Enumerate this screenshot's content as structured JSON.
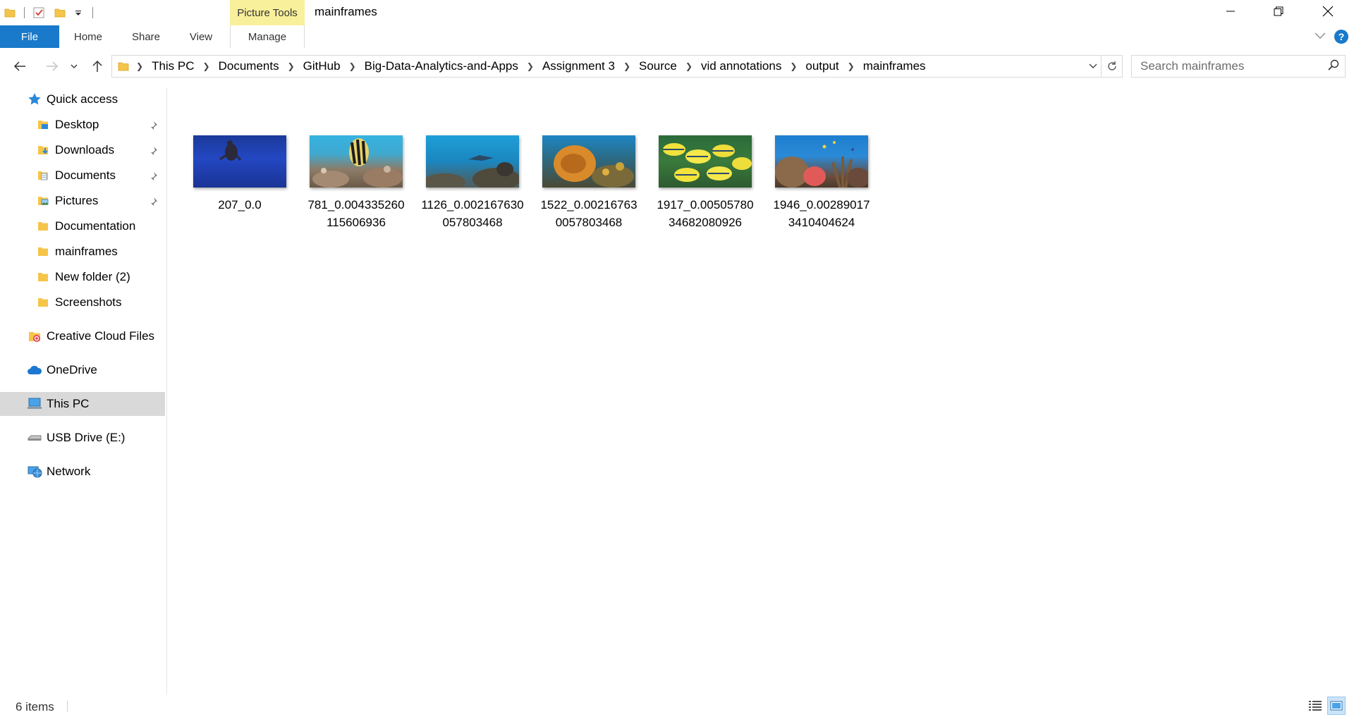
{
  "window": {
    "title": "mainframes",
    "context_tab_group": "Picture Tools"
  },
  "ribbon": {
    "tabs": [
      {
        "label": "File"
      },
      {
        "label": "Home"
      },
      {
        "label": "Share"
      },
      {
        "label": "View"
      },
      {
        "label": "Manage"
      }
    ]
  },
  "address_bar": {
    "breadcrumbs": [
      "This PC",
      "Documents",
      "GitHub",
      "Big-Data-Analytics-and-Apps",
      "Assignment 3",
      "Source",
      "vid annotations",
      "output",
      "mainframes"
    ]
  },
  "search": {
    "placeholder": "Search mainframes"
  },
  "nav_pane": {
    "quick_access": "Quick access",
    "pinned": [
      {
        "label": "Desktop",
        "icon": "desktop-folder-icon"
      },
      {
        "label": "Downloads",
        "icon": "downloads-folder-icon"
      },
      {
        "label": "Documents",
        "icon": "documents-folder-icon"
      },
      {
        "label": "Pictures",
        "icon": "pictures-folder-icon"
      }
    ],
    "recent": [
      {
        "label": "Documentation"
      },
      {
        "label": "mainframes"
      },
      {
        "label": "New folder (2)"
      },
      {
        "label": "Screenshots"
      }
    ],
    "creative_cloud": "Creative Cloud Files",
    "onedrive": "OneDrive",
    "this_pc": "This PC",
    "usb": "USB Drive (E:)",
    "network": "Network"
  },
  "files": [
    {
      "name": "207_0.0",
      "scene": "turtle in deep blue water"
    },
    {
      "name": "781_0.004335260115606936",
      "scene": "angelfish over coral reef"
    },
    {
      "name": "1126_0.002167630057803468",
      "scene": "ray over reef"
    },
    {
      "name": "1522_0.002167630057803468",
      "scene": "orange coral reef"
    },
    {
      "name": "1917_0.0050578034682080926",
      "scene": "school of yellow striped fish"
    },
    {
      "name": "1946_0.0028901734104046​24",
      "scene": "colorful reef with fish"
    }
  ],
  "status_bar": {
    "item_count": "6 items"
  },
  "colors": {
    "file_tab": "#1979ca",
    "context_tab": "#f9f09b",
    "selected_nav": "#d9d9d9"
  }
}
